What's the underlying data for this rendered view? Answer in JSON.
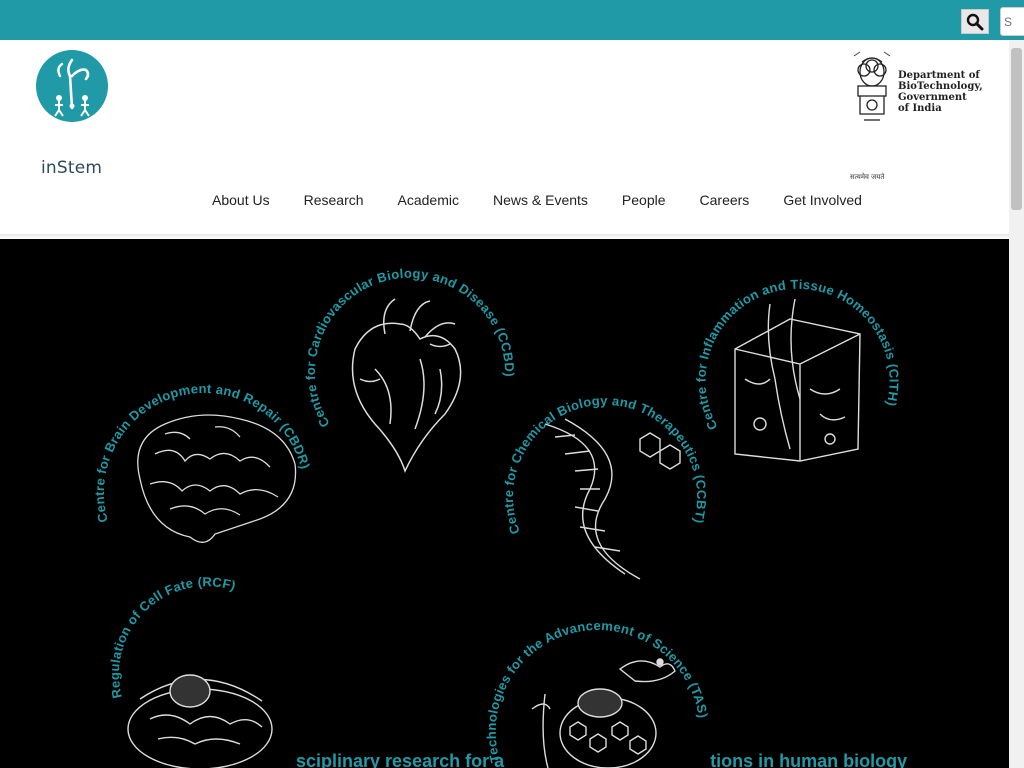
{
  "topbar": {
    "search_placeholder": "S",
    "search_icon": "search-icon"
  },
  "header": {
    "logo_text": "inStem",
    "dbt_lines": [
      "Department of",
      "BioTechnology,",
      "Government",
      "of India"
    ],
    "dbt_motto": "सत्यमेव जयते"
  },
  "nav": {
    "items": [
      "About Us",
      "Research",
      "Academic",
      "News & Events",
      "People",
      "Careers",
      "Get Involved"
    ]
  },
  "hero": {
    "centres": [
      "Centre for Cardiovascular Biology and Disease (CCBD)",
      "Centre for Brain Development and Repair (CBDR)",
      "Centre for Chemical Biology and Therapeutics (CCBT)",
      "Centre for Inflammation and Tissue Homeostasis (CITH)",
      "Regulation of Cell Fate (RCF)",
      "Technologies for the Advancement of Science (TAS)"
    ],
    "tagline_left": "sciplinary research for a",
    "tagline_right": "tions in human biology"
  },
  "colors": {
    "accent": "#1f9aa6",
    "hero_bg": "#000000"
  }
}
